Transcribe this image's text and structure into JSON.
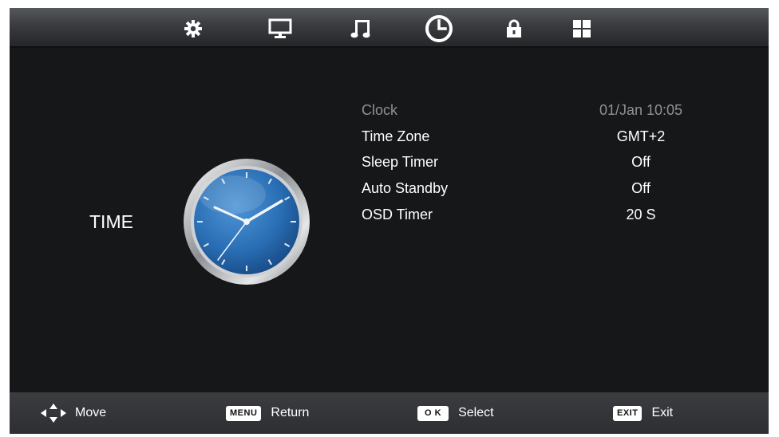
{
  "top_tabs": [
    {
      "id": "picture",
      "icon": "gear-icon"
    },
    {
      "id": "display",
      "icon": "monitor-icon"
    },
    {
      "id": "sound",
      "icon": "music-note-icon"
    },
    {
      "id": "time",
      "icon": "clock-icon",
      "selected": true
    },
    {
      "id": "lock",
      "icon": "lock-icon"
    },
    {
      "id": "setup",
      "icon": "grid-icon"
    }
  ],
  "section": {
    "title": "TIME"
  },
  "menu": {
    "items": [
      {
        "label": "Clock",
        "value": "01/Jan  10:05",
        "disabled": true
      },
      {
        "label": "Time Zone",
        "value": "GMT+2"
      },
      {
        "label": "Sleep Timer",
        "value": "Off"
      },
      {
        "label": "Auto Standby",
        "value": "Off"
      },
      {
        "label": "OSD Timer",
        "value": "20 S"
      }
    ]
  },
  "footer": {
    "move": {
      "label": "Move",
      "icon": "dpad-icon"
    },
    "menu": {
      "key": "MENU",
      "label": "Return"
    },
    "ok": {
      "key": "O K",
      "label": "Select"
    },
    "exit": {
      "key": "EXIT",
      "label": "Exit"
    }
  },
  "colors": {
    "background": "#161718",
    "bars": "#3a3c40",
    "text": "#ffffff",
    "disabled_text": "#8f9194",
    "clock_face": "#2a6fb5"
  }
}
